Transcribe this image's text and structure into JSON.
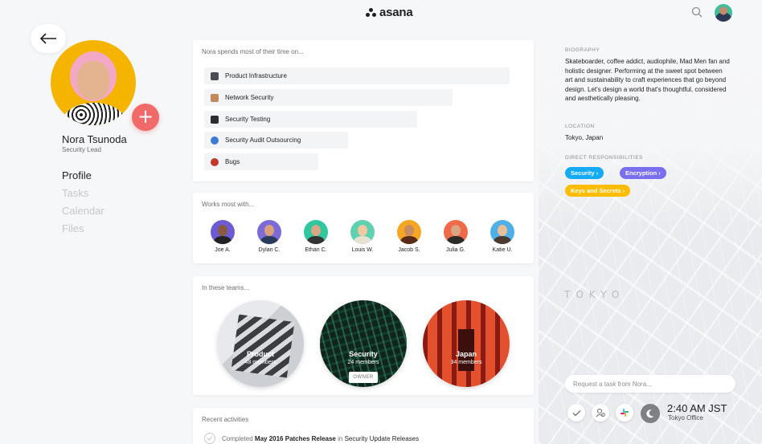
{
  "header": {
    "logo_text": "asana",
    "icons": [
      "search-icon",
      "user-avatar"
    ]
  },
  "profile": {
    "name": "Nora Tsunoda",
    "role": "Security Lead",
    "add_label": "+",
    "nav": [
      {
        "label": "Profile",
        "active": true
      },
      {
        "label": "Tasks",
        "active": false
      },
      {
        "label": "Calendar",
        "active": false
      },
      {
        "label": "Files",
        "active": false
      }
    ]
  },
  "time_card": {
    "title": "Nora spends most of their time on...",
    "items": [
      {
        "label": "Product Infrastructure",
        "icon": "server-icon",
        "color": "#4a4d52",
        "share": 1.0
      },
      {
        "label": "Network Security",
        "icon": "lock-icon",
        "color": "#c28a5a",
        "share": 0.81
      },
      {
        "label": "Security Testing",
        "icon": "spy-icon",
        "color": "#2b2d30",
        "share": 0.67
      },
      {
        "label": "Security Audit Outsourcing",
        "icon": "globe-icon",
        "color": "#3d7ad6",
        "share": 0.47
      },
      {
        "label": "Bugs",
        "icon": "bug-icon",
        "color": "#c0392b",
        "share": 0.38
      }
    ]
  },
  "works_card": {
    "title": "Works most with...",
    "people": [
      {
        "name": "Joe A.",
        "bg": "#6c5bd4"
      },
      {
        "name": "Dylan C.",
        "bg": "#7b6ad8"
      },
      {
        "name": "Ethan C.",
        "bg": "#2fc6a0"
      },
      {
        "name": "Louis W.",
        "bg": "#5fd0b0"
      },
      {
        "name": "Jacob S.",
        "bg": "#f5a623"
      },
      {
        "name": "Julia G.",
        "bg": "#f06a4a"
      },
      {
        "name": "Katie U.",
        "bg": "#4fb0e8"
      }
    ]
  },
  "teams_card": {
    "title": "In these teams...",
    "teams": [
      {
        "name": "Product",
        "members": "48 members"
      },
      {
        "name": "Security",
        "members": "24 members"
      },
      {
        "name": "Japan",
        "members": "34 members"
      }
    ],
    "owner_badge": "OWNER"
  },
  "activity_card": {
    "title": "Recent activities",
    "item": {
      "prefix": "Completed",
      "task": "May 2016 Patches Release",
      "connector": "in",
      "project": "Security Update Releases"
    }
  },
  "about": {
    "bio_label": "BIOGRAPHY",
    "bio": "Skateboarder, coffee addict, audiophile, Mad Men fan and holistic designer. Performing at the sweet spot between art and sustainability to craft experiences that go beyond design. Let's design a world that's thoughtful, considered and aesthetically pleasing.",
    "location_label": "LOCATION",
    "location": "Tokyo, Japan",
    "resp_label": "DIRECT RESPONSIBILITIES",
    "responsibilities": [
      {
        "label": "Security",
        "color": "#14aaf5"
      },
      {
        "label": "Encryption",
        "color": "#7a6ff0"
      },
      {
        "label": "Keys and Secrets",
        "color": "#fcbd01"
      }
    ],
    "chevron": "›"
  },
  "map": {
    "label": "TOKYO"
  },
  "request": {
    "placeholder": "Request a task from Nora...",
    "time": "2:40 AM JST",
    "zone": "Tokyo Office"
  }
}
